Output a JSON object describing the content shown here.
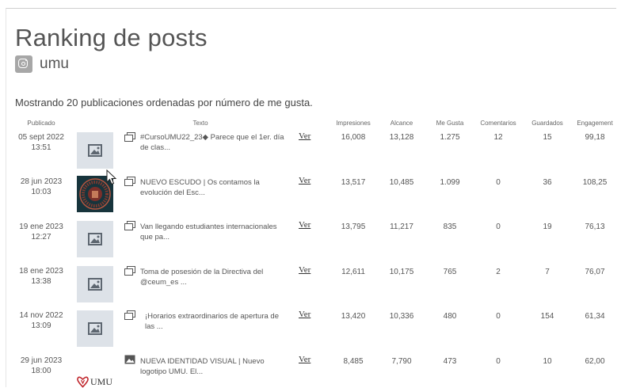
{
  "page": {
    "title": "Ranking de posts",
    "account": "umu",
    "summary": "Mostrando 20 publicaciones ordenadas por número de me gusta."
  },
  "columns": {
    "published": "Publicado",
    "text": "Texto",
    "impressions": "Impresiones",
    "reach": "Alcance",
    "likes": "Me Gusta",
    "comments": "Comentarios",
    "saves": "Guardados",
    "engagement": "Engagement"
  },
  "rows": [
    {
      "date": "05 sept 2022",
      "time": "13:51",
      "thumb": "placeholder-image-icon",
      "type": "carousel-icon",
      "text": "#CursoUMU22_23◆ Parece que el 1er. día de clas...",
      "link": "Ver",
      "impressions": "16,008",
      "reach": "13,128",
      "likes": "1.275",
      "comments": "12",
      "saves": "15",
      "engagement": "99,18"
    },
    {
      "date": "28 jun 2023",
      "time": "10:03",
      "thumb": "crest-image",
      "type": "carousel-icon",
      "text": "NUEVO ESCUDO | Os contamos la evolución del Esc...",
      "link": "Ver",
      "impressions": "13,517",
      "reach": "10,485",
      "likes": "1.099",
      "comments": "0",
      "saves": "36",
      "engagement": "108,25"
    },
    {
      "date": "19 ene 2023",
      "time": "12:27",
      "thumb": "placeholder-image-icon",
      "type": "carousel-icon",
      "text": "Van llegando estudiantes internacionales que pa...",
      "link": "Ver",
      "impressions": "13,795",
      "reach": "11,217",
      "likes": "835",
      "comments": "0",
      "saves": "19",
      "engagement": "76,13"
    },
    {
      "date": "18 ene 2023",
      "time": "13:38",
      "thumb": "placeholder-image-icon",
      "type": "carousel-icon",
      "text": "Toma de posesión de la Directiva del @ceum_es ...",
      "link": "Ver",
      "impressions": "12,611",
      "reach": "10,175",
      "likes": "765",
      "comments": "2",
      "saves": "7",
      "engagement": "76,07"
    },
    {
      "date": "14 nov 2022",
      "time": "13:09",
      "thumb": "placeholder-image-icon",
      "type": "carousel-icon",
      "text": "¡Horarios extraordinarios de apertura de las ...",
      "link": "Ver",
      "impressions": "13,420",
      "reach": "10,336",
      "likes": "480",
      "comments": "0",
      "saves": "154",
      "engagement": "61,34"
    },
    {
      "date": "29 jun 2023",
      "time": "18:00",
      "thumb": "umu-logo-image",
      "thumb_text": "UMU",
      "type": "image-icon",
      "text": "NUEVA IDENTIDAD VISUAL | Nuevo logotipo UMU. El...",
      "link": "Ver",
      "impressions": "8,485",
      "reach": "7,790",
      "likes": "473",
      "comments": "0",
      "saves": "10",
      "engagement": "62,00"
    }
  ]
}
